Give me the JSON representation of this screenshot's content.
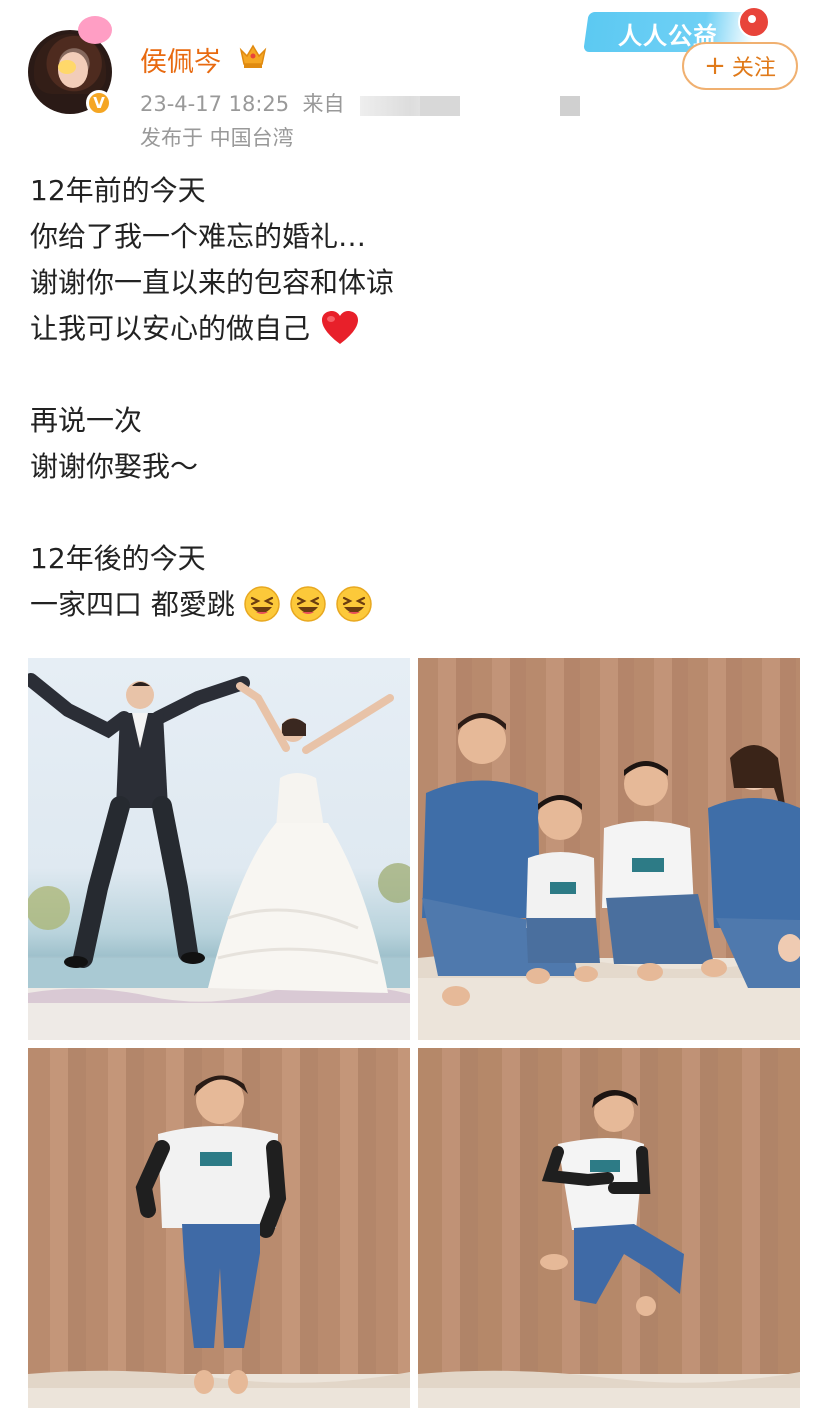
{
  "post": {
    "author": {
      "name": "侯佩岑",
      "verified_icon": "verified-v-icon",
      "badge_icon": "crown-icon"
    },
    "timestamp": "23-4-17 18:25",
    "source_prefix": "来自",
    "location": "发布于 中国台湾",
    "charity_badge": "人人公益",
    "follow_button": {
      "plus": "+",
      "label": "关注"
    },
    "lines": [
      "12年前的今天",
      "你给了我一个难忘的婚礼…",
      "谢谢你一直以来的包容和体谅",
      "让我可以安心的做自己",
      "",
      "再说一次",
      "谢谢你娶我～",
      "",
      "12年後的今天",
      "一家四口 都愛跳"
    ],
    "emoji": {
      "line4": "heart-emoji",
      "line10": [
        "laughing-emoji",
        "laughing-emoji",
        "laughing-emoji"
      ]
    },
    "photos": [
      {
        "name": "wedding-jump-photo"
      },
      {
        "name": "family-portrait-photo"
      },
      {
        "name": "boy-jump-photo"
      },
      {
        "name": "boy-jump-photo-2"
      }
    ]
  },
  "colors": {
    "author_name": "#e86a10",
    "meta_text": "#999999",
    "follow_border": "#f0b070",
    "body_text": "#222222"
  }
}
